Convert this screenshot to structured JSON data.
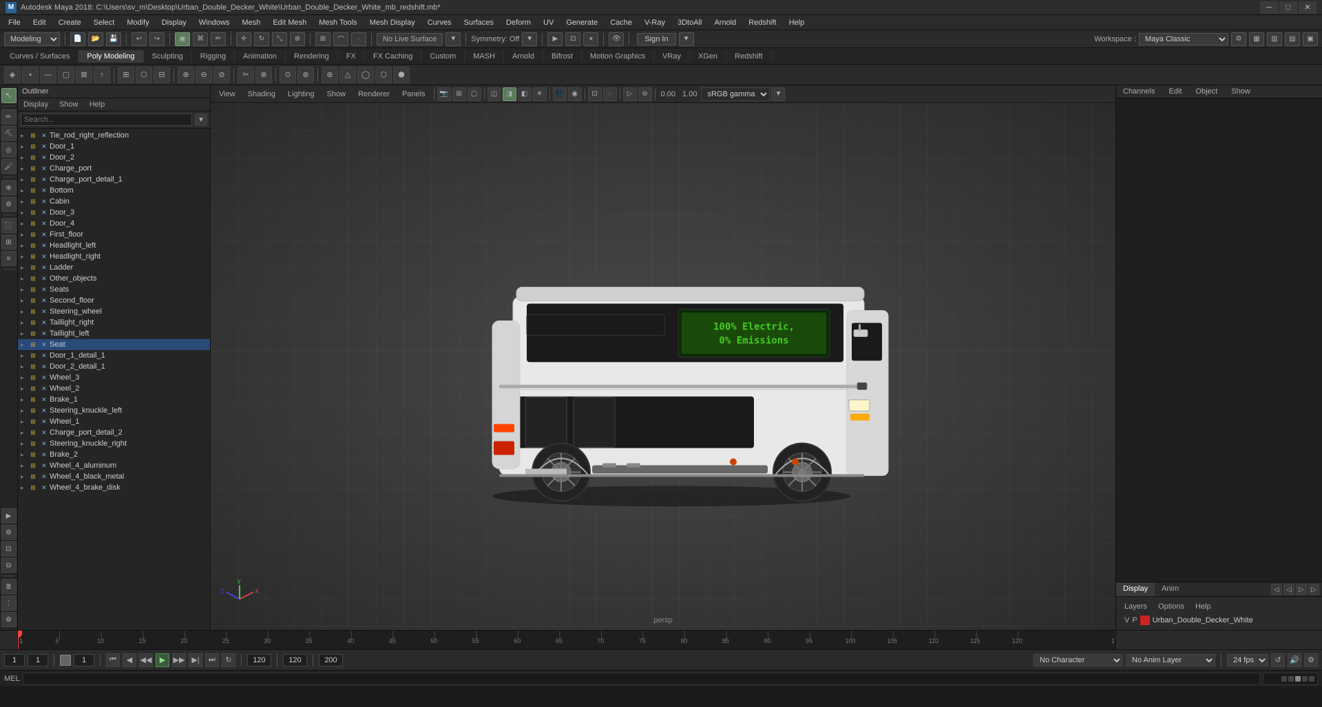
{
  "titlebar": {
    "title": "Autodesk Maya 2018: C:\\Users\\sv_m\\Desktop\\Urban_Double_Decker_White\\Urban_Double_Decker_White_mb_redshift.mb*",
    "icon": "M",
    "min": "─",
    "max": "□",
    "close": "✕"
  },
  "menu": {
    "items": [
      "File",
      "Edit",
      "Create",
      "Select",
      "Modify",
      "Display",
      "Windows",
      "Mesh",
      "Edit Mesh",
      "Mesh Tools",
      "Mesh Display",
      "Curves",
      "Surfaces",
      "Deform",
      "UV",
      "Generate",
      "Cache",
      "V-Ray",
      "3DtoAll",
      "Arnold",
      "Redshift",
      "Help"
    ]
  },
  "workspace": {
    "mode": "Modeling",
    "live_surface": "No Live Surface",
    "symmetry": "Symmetry: Off",
    "sign_in": "Sign In",
    "label": "Workspace :",
    "workspace_name": "Maya Classic"
  },
  "tabs": {
    "items": [
      "Curves / Surfaces",
      "Poly Modeling",
      "Sculpting",
      "Rigging",
      "Animation",
      "Rendering",
      "FX",
      "FX Caching",
      "Custom",
      "MASH",
      "Arnold",
      "Bifrost",
      "Motion Graphics",
      "VRay",
      "XGen",
      "Redshift"
    ]
  },
  "outliner": {
    "title": "Outliner",
    "tabs": [
      "Display",
      "Show",
      "Help"
    ],
    "search_placeholder": "Search...",
    "items": [
      {
        "name": "Tie_rod_right_reflection",
        "type": "mesh",
        "depth": 0
      },
      {
        "name": "Door_1",
        "type": "mesh",
        "depth": 0
      },
      {
        "name": "Door_2",
        "type": "mesh",
        "depth": 0
      },
      {
        "name": "Charge_port",
        "type": "mesh",
        "depth": 0
      },
      {
        "name": "Charge_port_detail_1",
        "type": "mesh",
        "depth": 0
      },
      {
        "name": "Bottom",
        "type": "mesh",
        "depth": 0
      },
      {
        "name": "Cabin",
        "type": "mesh",
        "depth": 0
      },
      {
        "name": "Door_3",
        "type": "mesh",
        "depth": 0
      },
      {
        "name": "Door_4",
        "type": "mesh",
        "depth": 0
      },
      {
        "name": "First_floor",
        "type": "mesh",
        "depth": 0
      },
      {
        "name": "Headlight_left",
        "type": "mesh",
        "depth": 0
      },
      {
        "name": "Headlight_right",
        "type": "mesh",
        "depth": 0
      },
      {
        "name": "Ladder",
        "type": "mesh",
        "depth": 0
      },
      {
        "name": "Other_objects",
        "type": "mesh",
        "depth": 0
      },
      {
        "name": "Seats",
        "type": "mesh",
        "depth": 0
      },
      {
        "name": "Second_floor",
        "type": "mesh",
        "depth": 0
      },
      {
        "name": "Steering_wheel",
        "type": "mesh",
        "depth": 0
      },
      {
        "name": "Taillight_right",
        "type": "mesh",
        "depth": 0
      },
      {
        "name": "Taillight_left",
        "type": "mesh",
        "depth": 0
      },
      {
        "name": "Seat",
        "type": "mesh",
        "depth": 0
      },
      {
        "name": "Door_1_detail_1",
        "type": "mesh",
        "depth": 0
      },
      {
        "name": "Door_2_detail_1",
        "type": "mesh",
        "depth": 0
      },
      {
        "name": "Wheel_3",
        "type": "mesh",
        "depth": 0
      },
      {
        "name": "Wheel_2",
        "type": "mesh",
        "depth": 0
      },
      {
        "name": "Brake_1",
        "type": "mesh",
        "depth": 0
      },
      {
        "name": "Steering_knuckle_left",
        "type": "mesh",
        "depth": 0
      },
      {
        "name": "Wheel_1",
        "type": "mesh",
        "depth": 0
      },
      {
        "name": "Charge_port_detail_2",
        "type": "mesh",
        "depth": 0
      },
      {
        "name": "Steering_knuckle_right",
        "type": "mesh",
        "depth": 0
      },
      {
        "name": "Brake_2",
        "type": "mesh",
        "depth": 0
      },
      {
        "name": "Wheel_4_aluminum",
        "type": "mesh",
        "depth": 0
      },
      {
        "name": "Wheel_4_black_metal",
        "type": "mesh",
        "depth": 0
      },
      {
        "name": "Wheel_4_brake_disk",
        "type": "mesh",
        "depth": 0
      }
    ]
  },
  "viewport": {
    "tabs": [
      "View",
      "Shading",
      "Lighting",
      "Show",
      "Renderer",
      "Panels"
    ],
    "persp_label": "persp",
    "gamma": "sRGB gamma",
    "val1": "0.00",
    "val2": "1.00"
  },
  "right_panel": {
    "tabs": [
      "Channels",
      "Edit",
      "Object",
      "Show"
    ],
    "display_tabs": [
      "Display",
      "Anim"
    ],
    "layer_tabs": [
      "Layers",
      "Options",
      "Help"
    ],
    "layer_vp": "V",
    "layer_p": "P",
    "layer_name": "Urban_Double_Decker_White",
    "layer_color": "#cc2222"
  },
  "timeline": {
    "start": "1",
    "end": "120",
    "current": "1",
    "ticks": [
      "1",
      "5",
      "10",
      "15",
      "20",
      "25",
      "30",
      "35",
      "40",
      "45",
      "50",
      "55",
      "60",
      "65",
      "70",
      "75",
      "80",
      "85",
      "90",
      "95",
      "100",
      "105",
      "110",
      "115",
      "120",
      "1"
    ]
  },
  "bottom_bar": {
    "frame_start": "1",
    "frame_current": "1",
    "range_start": "1",
    "range_end": "120",
    "max_frame": "120",
    "end_frame": "200",
    "no_character": "No Character",
    "no_anim_layer": "No Anim Layer",
    "fps": "24 fps",
    "transport_buttons": [
      "⏮",
      "◀◀",
      "◀",
      "▶",
      "▶▶",
      "⏭"
    ]
  },
  "mel_bar": {
    "label": "MEL",
    "placeholder": ""
  }
}
